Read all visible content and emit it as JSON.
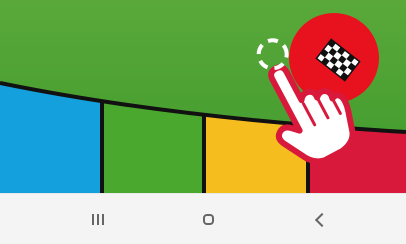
{
  "scene": {
    "description_icons": [
      "checkered-flag-icon",
      "tap-hand-icon"
    ],
    "colors": {
      "sky_top": "#5aa83a",
      "sky_bottom": "#3f9a2c",
      "segment_blue": "#14a0dc",
      "segment_green": "#4aa82e",
      "segment_yellow": "#f5be1e",
      "segment_red": "#d8193c",
      "outline": "#111111",
      "badge_red": "#e8121e",
      "hand_red": "#d8193c"
    }
  },
  "navigation_bar": {
    "buttons": [
      {
        "name": "recent-apps",
        "icon": "recents-icon"
      },
      {
        "name": "home",
        "icon": "home-icon"
      },
      {
        "name": "back",
        "icon": "back-icon"
      }
    ],
    "background": "#f4f4f4",
    "icon_color": "#666666"
  }
}
